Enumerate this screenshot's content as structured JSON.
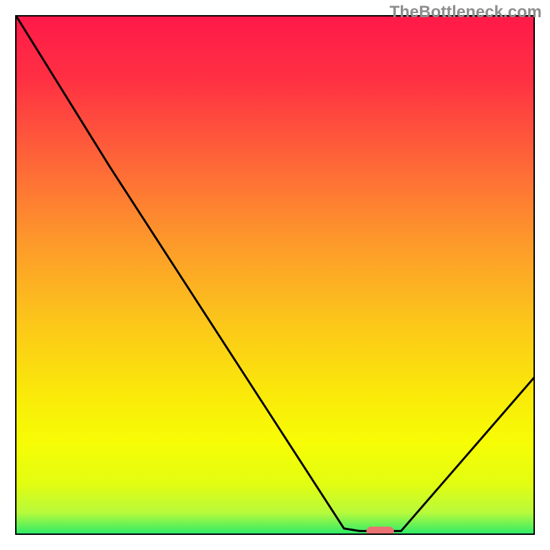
{
  "watermark": "TheBottleneck.com",
  "gradient_stops": [
    {
      "o": 0.0,
      "c": "#ff1a49"
    },
    {
      "o": 0.12,
      "c": "#ff3043"
    },
    {
      "o": 0.28,
      "c": "#fe6638"
    },
    {
      "o": 0.44,
      "c": "#fd9b2a"
    },
    {
      "o": 0.58,
      "c": "#fcc41b"
    },
    {
      "o": 0.72,
      "c": "#fae80a"
    },
    {
      "o": 0.82,
      "c": "#f7fd05"
    },
    {
      "o": 0.9,
      "c": "#e2fd12"
    },
    {
      "o": 0.955,
      "c": "#b7fa3b"
    },
    {
      "o": 1.0,
      "c": "#1eea6e"
    }
  ],
  "marker": {
    "x_frac": 0.7,
    "y_frac": 0.991,
    "label": "optimal-region"
  },
  "chart_data": {
    "type": "line",
    "title": "",
    "xlabel": "",
    "ylabel": "",
    "xlim": [
      0,
      100
    ],
    "ylim": [
      0,
      100
    ],
    "series": [
      {
        "name": "bottleneck-curve",
        "x": [
          0,
          18,
          63,
          66,
          74,
          100
        ],
        "y": [
          100,
          71,
          1.5,
          1.0,
          1.0,
          31
        ]
      }
    ],
    "annotations": [
      {
        "text": "TheBottleneck.com",
        "pos": "top-right",
        "role": "watermark"
      }
    ]
  }
}
